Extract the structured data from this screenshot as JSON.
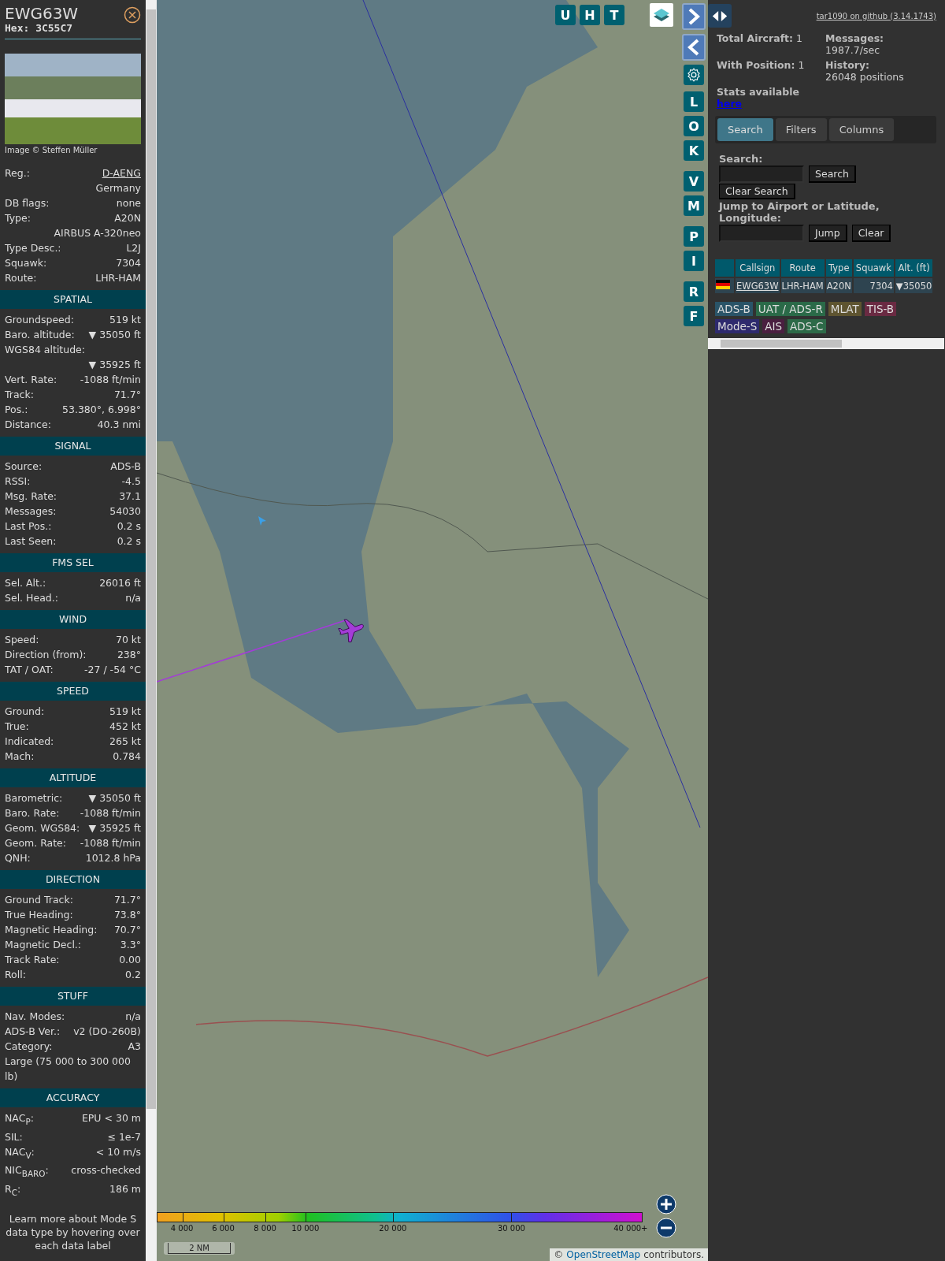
{
  "aircraft": {
    "callsign": "EWG63W",
    "hex": "Hex: 3C55C7",
    "photo_credit": "Image © Steffen Müller",
    "registration": {
      "label": "Reg.:",
      "value": "D-AENG"
    },
    "rows": [
      {
        "value": "Germany"
      },
      {
        "label": "DB flags:",
        "value": "none"
      },
      {
        "label": "Type:",
        "value": "A20N"
      },
      {
        "value": "AIRBUS A-320neo"
      },
      {
        "label": "Type Desc.:",
        "value": "L2J"
      },
      {
        "label": "Squawk:",
        "value": "7304"
      },
      {
        "label": "Route:",
        "value": "LHR-HAM"
      }
    ]
  },
  "sections": [
    {
      "title": "SPATIAL",
      "rows": [
        {
          "label": "Groundspeed:",
          "value": "519 kt"
        },
        {
          "label": "Baro. altitude:",
          "value": "▼ 35050 ft"
        },
        {
          "label": "WGS84 altitude:"
        },
        {
          "value": "▼ 35925 ft"
        },
        {
          "label": "Vert. Rate:",
          "value": "-1088 ft/min"
        },
        {
          "label": "Track:",
          "value": "71.7°"
        },
        {
          "label": "Pos.:",
          "value": "53.380°, 6.998°"
        },
        {
          "label": "Distance:",
          "value": "40.3 nmi"
        }
      ]
    },
    {
      "title": "SIGNAL",
      "rows": [
        {
          "label": "Source:",
          "value": "ADS-B"
        },
        {
          "label": "RSSI:",
          "value": "-4.5"
        },
        {
          "label": "Msg. Rate:",
          "value": "37.1"
        },
        {
          "label": "Messages:",
          "value": "54030"
        },
        {
          "label": "Last Pos.:",
          "value": "0.2 s"
        },
        {
          "label": "Last Seen:",
          "value": "0.2 s"
        }
      ]
    },
    {
      "title": "FMS SEL",
      "rows": [
        {
          "label": "Sel. Alt.:",
          "value": "26016 ft"
        },
        {
          "label": "Sel. Head.:",
          "value": "n/a"
        }
      ]
    },
    {
      "title": "WIND",
      "rows": [
        {
          "label": "Speed:",
          "value": "70 kt"
        },
        {
          "label": "Direction (from):",
          "value": "238°"
        },
        {
          "label": "TAT / OAT:",
          "value": "-27 / -54 °C"
        }
      ]
    },
    {
      "title": "SPEED",
      "rows": [
        {
          "label": "Ground:",
          "value": "519 kt"
        },
        {
          "label": "True:",
          "value": "452 kt"
        },
        {
          "label": "Indicated:",
          "value": "265 kt"
        },
        {
          "label": "Mach:",
          "value": "0.784"
        }
      ]
    },
    {
      "title": "ALTITUDE",
      "rows": [
        {
          "label": "Barometric:",
          "value": "▼ 35050 ft"
        },
        {
          "label": "Baro. Rate:",
          "value": "-1088 ft/min"
        },
        {
          "label": "Geom. WGS84:",
          "value": "▼ 35925 ft"
        },
        {
          "label": "Geom. Rate:",
          "value": "-1088 ft/min"
        },
        {
          "label": "QNH:",
          "value": "1012.8 hPa"
        }
      ]
    },
    {
      "title": "DIRECTION",
      "rows": [
        {
          "label": "Ground Track:",
          "value": "71.7°"
        },
        {
          "label": "True Heading:",
          "value": "73.8°"
        },
        {
          "label": "Magnetic Heading:",
          "value": "70.7°"
        },
        {
          "label": "Magnetic Decl.:",
          "value": "3.3°"
        },
        {
          "label": "Track Rate:",
          "value": "0.00"
        },
        {
          "label": "Roll:",
          "value": "0.2"
        }
      ]
    },
    {
      "title": "STUFF",
      "rows": [
        {
          "label": "Nav. Modes:",
          "value": "n/a"
        },
        {
          "label": "ADS-B Ver.:",
          "value": "v2 (DO-260B)"
        },
        {
          "label": "Category:",
          "value": "A3"
        },
        {
          "label": "Large (75 000 to 300 000 lb)"
        }
      ]
    },
    {
      "title": "ACCURACY",
      "rows": [
        {
          "label": "NAC$_{P}$:",
          "value": "EPU < 30 m"
        },
        {
          "label": "SIL:",
          "value": "≤ 1e-7"
        },
        {
          "label": "NAC$_{V}$:",
          "value": "< 10 m/s"
        },
        {
          "label": "NIC$_{BARO}$:",
          "value": "cross-checked"
        },
        {
          "label": "R$_{C}$:",
          "value": "186 m"
        }
      ]
    }
  ],
  "footer_note": "Learn more about Mode S data type by hovering over each data label",
  "map": {
    "top_buttons": [
      "U",
      "H",
      "T"
    ],
    "side_button_groups": [
      [
        "L",
        "O",
        "K"
      ],
      [
        "V",
        "M"
      ],
      [
        "P",
        "I"
      ],
      [
        "R",
        "F"
      ]
    ],
    "altitude_legend": [
      "4 000",
      "6 000",
      "8 000",
      "10 000",
      "20 000",
      "30 000",
      "40 000+"
    ],
    "scale": "2 NM",
    "attribution_prefix": "©",
    "attribution_link": "OpenStreetMap",
    "attribution_suffix": "contributors."
  },
  "panel": {
    "version_link": "tar1090 on github (3.14.1743)",
    "stats": [
      {
        "label": "Total Aircraft:",
        "value": "1"
      },
      {
        "label": "Messages:",
        "value": "1987.7/sec"
      },
      {
        "label": "With Position:",
        "value": "1"
      },
      {
        "label": "History:",
        "value": "26048 positions"
      }
    ],
    "stats_text": "Stats available",
    "stats_link": "here",
    "tabs": [
      {
        "label": "Search",
        "selected": true
      },
      {
        "label": "Filters",
        "selected": false
      },
      {
        "label": "Columns",
        "selected": false
      }
    ],
    "search_label": "Search:",
    "search_button": "Search",
    "clear_search_button": "Clear Search",
    "jump_label": "Jump to Airport or Latitude, Longitude:",
    "jump_button": "Jump",
    "clear_button": "Clear",
    "table": {
      "columns": [
        "Callsign",
        "Route",
        "Type",
        "Squawk",
        "Alt. (ft)"
      ],
      "rows": [
        {
          "callsign": "EWG63W",
          "route": "LHR-HAM",
          "type": "A20N",
          "squawk": "7304",
          "altitude": "▼35050"
        }
      ]
    },
    "sources": [
      {
        "label": "ADS-B",
        "color": "#2a5468"
      },
      {
        "label": "UAT / ADS-R",
        "color": "#2a6a48"
      },
      {
        "label": "MLAT",
        "color": "#5e5430"
      },
      {
        "label": "TIS-B",
        "color": "#6a2a42"
      },
      {
        "label": "Mode-S",
        "color": "#2e2a6e"
      },
      {
        "label": "AIS",
        "color": "#4a1f40"
      },
      {
        "label": "ADS-C",
        "color": "#2d6a48"
      }
    ]
  }
}
